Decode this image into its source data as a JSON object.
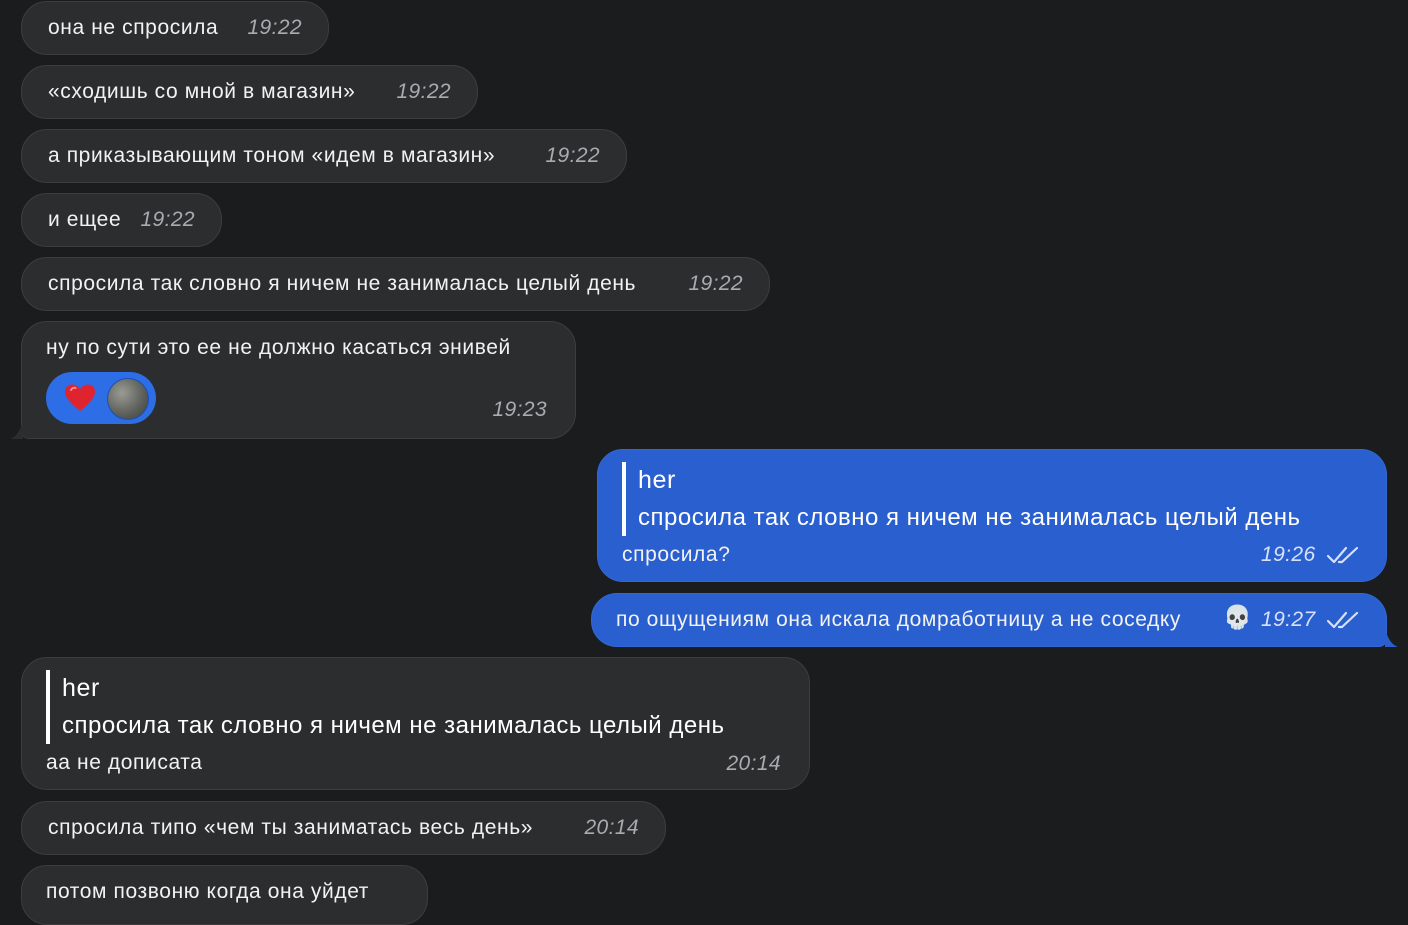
{
  "messages": [
    {
      "text": "она не спросила",
      "time": "19:22"
    },
    {
      "text": "«сходишь со мной в магазин»",
      "time": "19:22"
    },
    {
      "text": "а приказывающим тоном «идем в магазин»",
      "time": "19:22"
    },
    {
      "text": "и ещее",
      "time": "19:22"
    },
    {
      "text": "спросила так словно я ничем не занималась целый день",
      "time": "19:22"
    },
    {
      "text": "ну по сути это ее не должно касаться энивей",
      "time": "19:23",
      "reaction": {
        "emoji": "heart",
        "avatar": "reactor-avatar"
      }
    },
    {
      "quote_title": "her",
      "quote_text": "спросила так словно я ничем не занималась целый день",
      "text": "спросила?",
      "time": "19:26",
      "status": "read"
    },
    {
      "text": "по ощущениям она искала домработницу а не соседку",
      "emoji": "💀",
      "time": "19:27",
      "status": "read"
    },
    {
      "quote_title": "her",
      "quote_text": "спросила так словно я ничем не занималась целый день",
      "text": "аа не дописата",
      "time": "20:14"
    },
    {
      "text": "спросила типо «чем ты заниматась весь день»",
      "time": "20:14"
    },
    {
      "text": "потом позвоню когда она уйдет"
    }
  ],
  "colors": {
    "background": "#1a1c1d",
    "incoming": "#2c2d2e",
    "outgoing": "#2a5fcf",
    "reaction": "#2d6de6",
    "heart": "#e0242f"
  },
  "icons": [
    "heart-icon",
    "double-check-icon",
    "skull-emoji"
  ]
}
